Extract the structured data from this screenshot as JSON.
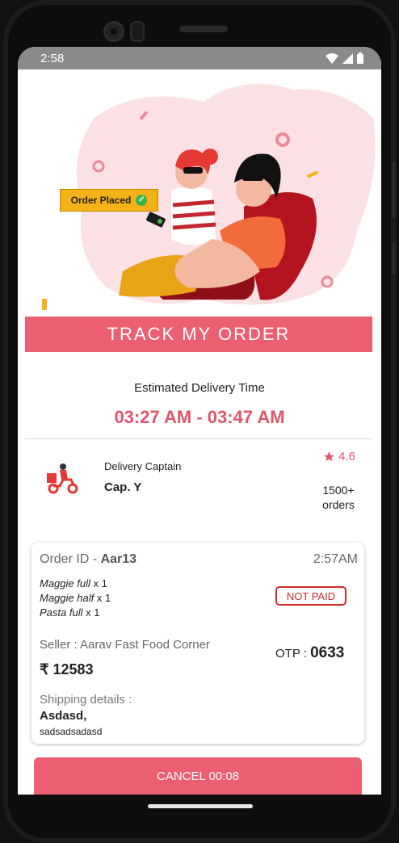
{
  "status_bar": {
    "time": "2:58"
  },
  "hero": {
    "badge_label": "Order Placed"
  },
  "banner": {
    "title": "TRACK MY ORDER"
  },
  "delivery": {
    "label": "Estimated Delivery Time",
    "window": "03:27 AM - 03:47 AM"
  },
  "captain": {
    "role": "Delivery Captain",
    "name": "Cap. Y",
    "rating": "4.6",
    "orders_line1": "1500+",
    "orders_line2": "orders"
  },
  "order": {
    "id_label": "Order ID - ",
    "id": "Aar13",
    "time": "2:57AM",
    "items": [
      {
        "name": "Maggie full",
        "qty": " x 1"
      },
      {
        "name": "Maggie half",
        "qty": " x 1"
      },
      {
        "name": "Pasta full ",
        "qty": " x 1"
      }
    ],
    "payment_status": "NOT PAID",
    "seller": "Seller : Aarav Fast Food Corner",
    "otp_label": "OTP : ",
    "otp": "0633",
    "price": "₹ 12583",
    "shipping_label": "Shipping details :",
    "shipping_name": "Asdasd,",
    "shipping_address": "sadsadsadasd"
  },
  "cancel_button": {
    "label": "CANCEL 00:08"
  },
  "colors": {
    "accent": "#ec5f70",
    "accent_text": "#e0566b",
    "badge": "#f5b216",
    "not_paid": "#d32a2a",
    "status_bar": "#8a8a8a"
  },
  "icons": [
    "wifi-icon",
    "signal-icon",
    "battery-icon",
    "check-icon",
    "star-icon",
    "delivery-scooter-icon"
  ]
}
